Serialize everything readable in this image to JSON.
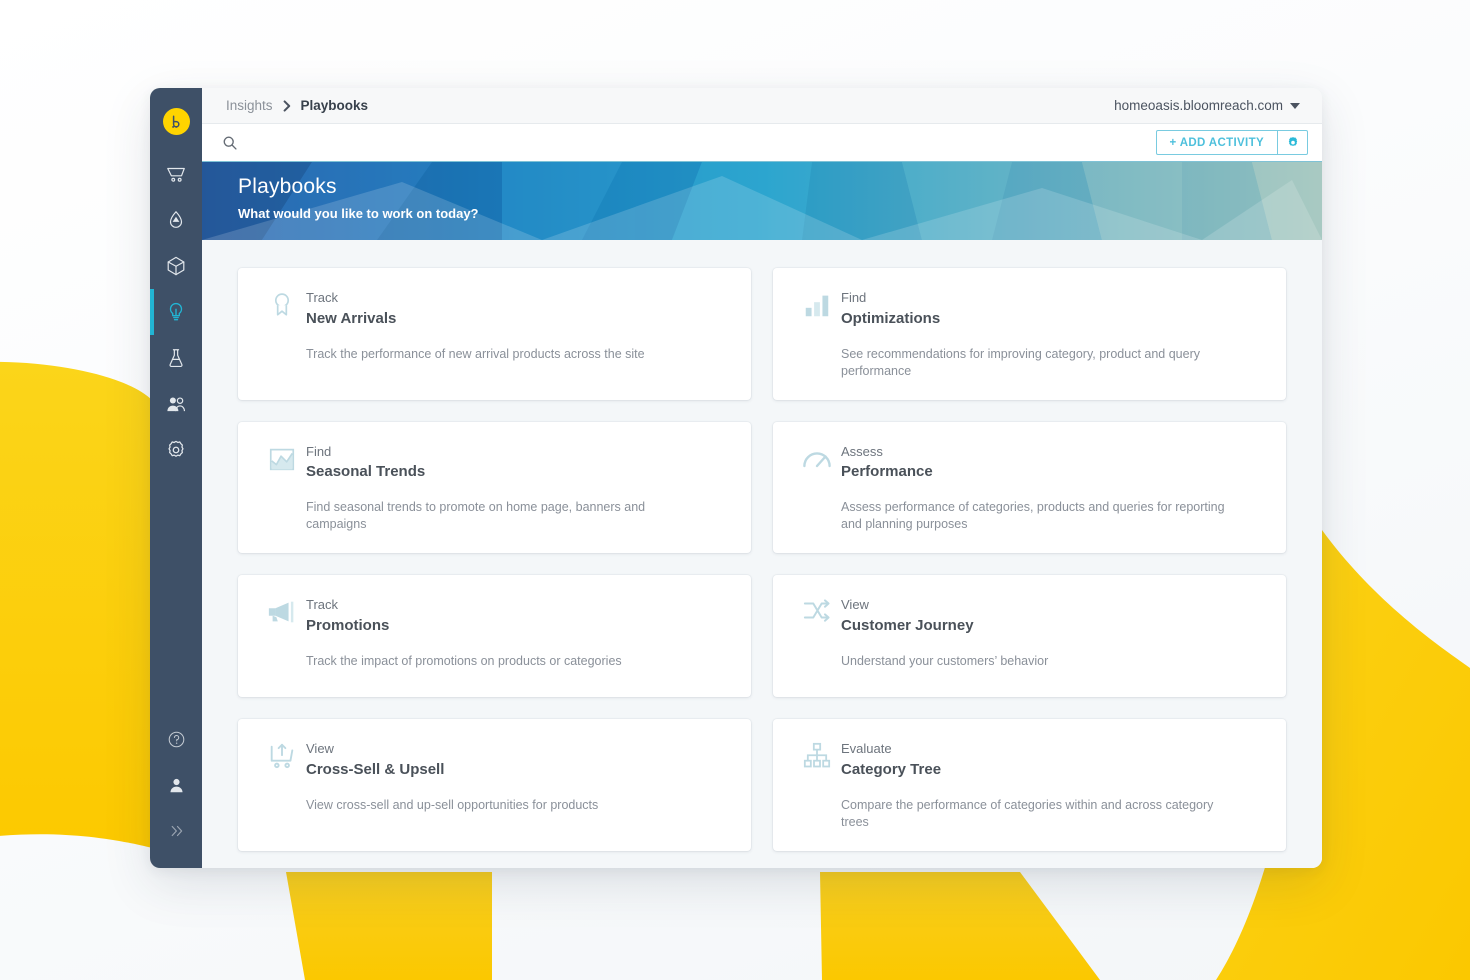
{
  "background": {
    "accent_yellow": "#fbcf0a",
    "accent_yellow_dark": "#f5c400",
    "page_bg": "#f4f7f9"
  },
  "rail": {
    "logo": {
      "name": "bloomreach-logo",
      "glyph": "b",
      "color": "#ffd400"
    },
    "items": [
      {
        "name": "cart-icon",
        "label": "Commerce",
        "active": false
      },
      {
        "name": "leaf-icon",
        "label": "Content",
        "active": false
      },
      {
        "name": "cube-icon",
        "label": "Products",
        "active": false
      },
      {
        "name": "bulb-icon",
        "label": "Insights",
        "active": true
      },
      {
        "name": "flask-icon",
        "label": "Experiments",
        "active": false
      },
      {
        "name": "people-icon",
        "label": "Audiences",
        "active": false
      },
      {
        "name": "gear-icon",
        "label": "Settings",
        "active": false
      }
    ],
    "bottom_items": [
      {
        "name": "help-icon",
        "label": "Help"
      },
      {
        "name": "user-icon",
        "label": "Account"
      },
      {
        "name": "expand-chevrons-icon",
        "label": "Expand menu"
      }
    ],
    "active_indicator_color": "#22b5d4",
    "background_color": "#3e5067"
  },
  "topbar": {
    "breadcrumb": {
      "parent": "Insights",
      "separator": "›",
      "current": "Playbooks"
    },
    "domain": "homeoasis.bloomreach.com"
  },
  "search": {
    "placeholder": "",
    "value": "",
    "icon": "search-icon",
    "add_activity_label": "+ ADD ACTIVITY",
    "settings_icon": "gear-icon",
    "accent": "#4ec0dc"
  },
  "hero": {
    "title": "Playbooks",
    "subtitle": "What would you like to work on today?",
    "gradient_from": "#2f6fb5",
    "gradient_to": "#9fc5c2"
  },
  "cards": [
    {
      "icon": "award-ribbon-icon",
      "kicker": "Track",
      "title": "New Arrivals",
      "description": "Track the performance of new arrival products across the site"
    },
    {
      "icon": "bar-chart-icon",
      "kicker": "Find",
      "title": "Optimizations",
      "description": "See recommendations for improving category, product and query performance"
    },
    {
      "icon": "area-chart-icon",
      "kicker": "Find",
      "title": "Seasonal Trends",
      "description": "Find seasonal trends to promote on home page, banners and campaigns"
    },
    {
      "icon": "gauge-icon",
      "kicker": "Assess",
      "title": "Performance",
      "description": "Assess performance of categories, products and queries for reporting and planning purposes"
    },
    {
      "icon": "megaphone-icon",
      "kicker": "Track",
      "title": "Promotions",
      "description": "Track the impact of promotions on products or categories"
    },
    {
      "icon": "shuffle-icon",
      "kicker": "View",
      "title": "Customer Journey",
      "description": "Understand your customers’ behavior"
    },
    {
      "icon": "cart-up-arrow-icon",
      "kicker": "View",
      "title": "Cross-Sell & Upsell",
      "description": "View cross-sell and up-sell opportunities for products"
    },
    {
      "icon": "hierarchy-tree-icon",
      "kicker": "Evaluate",
      "title": "Category Tree",
      "description": "Compare the performance of categories within and across category trees"
    }
  ]
}
